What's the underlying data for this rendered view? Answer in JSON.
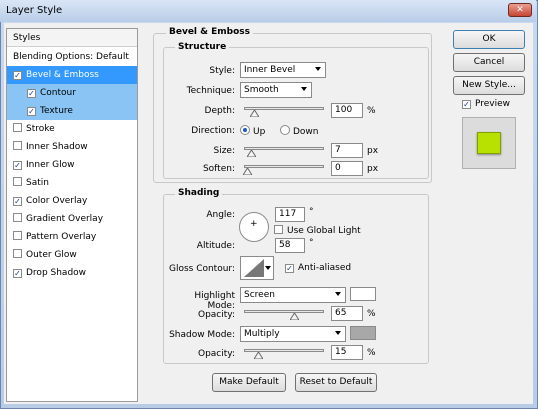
{
  "window": {
    "title": "Layer Style",
    "close_glyph": "✕"
  },
  "left_panel": {
    "header": "Styles",
    "items": [
      {
        "label": "Blending Options: Default",
        "checkbox": false
      },
      {
        "label": "Bevel & Emboss",
        "checkbox": true,
        "checked": true,
        "selected": true
      },
      {
        "label": "Contour",
        "checkbox": true,
        "checked": true,
        "sub": true
      },
      {
        "label": "Texture",
        "checkbox": true,
        "checked": true,
        "sub": true
      },
      {
        "label": "Stroke",
        "checkbox": true,
        "checked": false
      },
      {
        "label": "Inner Shadow",
        "checkbox": true,
        "checked": false
      },
      {
        "label": "Inner Glow",
        "checkbox": true,
        "checked": true
      },
      {
        "label": "Satin",
        "checkbox": true,
        "checked": false
      },
      {
        "label": "Color Overlay",
        "checkbox": true,
        "checked": true
      },
      {
        "label": "Gradient Overlay",
        "checkbox": true,
        "checked": false
      },
      {
        "label": "Pattern Overlay",
        "checkbox": true,
        "checked": false
      },
      {
        "label": "Outer Glow",
        "checkbox": true,
        "checked": false
      },
      {
        "label": "Drop Shadow",
        "checkbox": true,
        "checked": true
      }
    ]
  },
  "bevel": {
    "section_title": "Bevel & Emboss",
    "structure_title": "Structure",
    "style_label": "Style:",
    "style_value": "Inner Bevel",
    "technique_label": "Technique:",
    "technique_value": "Smooth",
    "depth_label": "Depth:",
    "depth_value": "100",
    "depth_unit": "%",
    "depth_level": 0.1,
    "direction_label": "Direction:",
    "direction_up": "Up",
    "direction_down": "Down",
    "direction_selected": "Up",
    "size_label": "Size:",
    "size_value": "7",
    "size_unit": "px",
    "size_level": 0.05,
    "soften_label": "Soften:",
    "soften_value": "0",
    "soften_unit": "px",
    "soften_level": 0.0
  },
  "shading": {
    "title": "Shading",
    "angle_label": "Angle:",
    "angle_value": "117",
    "degree": "°",
    "use_global_light": "Use Global Light",
    "use_global_light_checked": false,
    "altitude_label": "Altitude:",
    "altitude_value": "58",
    "gloss_label": "Gloss Contour:",
    "anti_aliased": "Anti-aliased",
    "anti_aliased_checked": true,
    "highlight_label": "Highlight Mode:",
    "highlight_value": "Screen",
    "highlight_color": "#ffffff",
    "hl_opacity_label": "Opacity:",
    "hl_opacity_value": "65",
    "hl_opacity_level": 0.65,
    "shadow_label": "Shadow Mode:",
    "shadow_value": "Multiply",
    "shadow_color": "#a8a8a8",
    "sh_opacity_label": "Opacity:",
    "sh_opacity_value": "15",
    "sh_opacity_level": 0.15,
    "percent": "%"
  },
  "buttons": {
    "make_default": "Make Default",
    "reset_default": "Reset to Default",
    "ok": "OK",
    "cancel": "Cancel",
    "new_style": "New Style...",
    "preview": "Preview",
    "preview_checked": true,
    "preview_color": "#b8e000"
  }
}
